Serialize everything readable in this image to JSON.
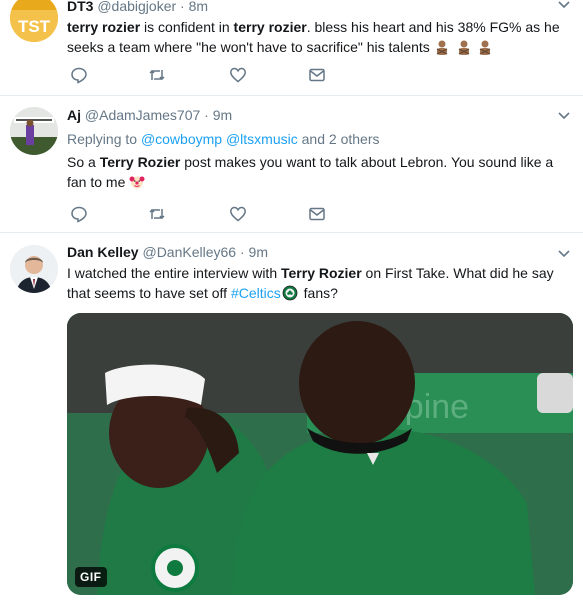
{
  "tweets": [
    {
      "name": "DT3",
      "handle": "@dabigjoker",
      "sep": "·",
      "time": "8m",
      "text_parts": [
        "terry rozier",
        " is confident in ",
        "terry rozier",
        ". bless his heart and his 38% FG% as he seeks a team where \"he won't have to sacrifice\" his talents"
      ],
      "avatar_text": "TST"
    },
    {
      "name": "Aj",
      "handle": "@AdamJames707",
      "sep": "·",
      "time": "9m",
      "reply_prefix": "Replying to",
      "reply_user1": "@cowboymp",
      "reply_user2": "@ltsxmusic",
      "reply_suffix": "and 2 others",
      "text_parts": [
        "So a ",
        "Terry Rozier",
        " post makes you want to talk about Lebron. You sound like a fan to me"
      ]
    },
    {
      "name": "Dan Kelley",
      "handle": "@DanKelley66",
      "sep": "·",
      "time": "9m",
      "text_parts": [
        "I watched the entire interview with ",
        "Terry Rozier",
        " on First Take. What did he say that seems to have set off ",
        "#Celtics",
        " fans?"
      ],
      "gif_label": "GIF",
      "gif_wall_text": "lerpine"
    }
  ],
  "icons": [
    "reply-icon",
    "retweet-icon",
    "like-icon",
    "dm-icon",
    "chevron-down-icon"
  ],
  "colors": {
    "link": "#1da1f2",
    "muted": "#657786",
    "divider": "#e6ecf0",
    "celtics_green": "#0f7a3f"
  }
}
